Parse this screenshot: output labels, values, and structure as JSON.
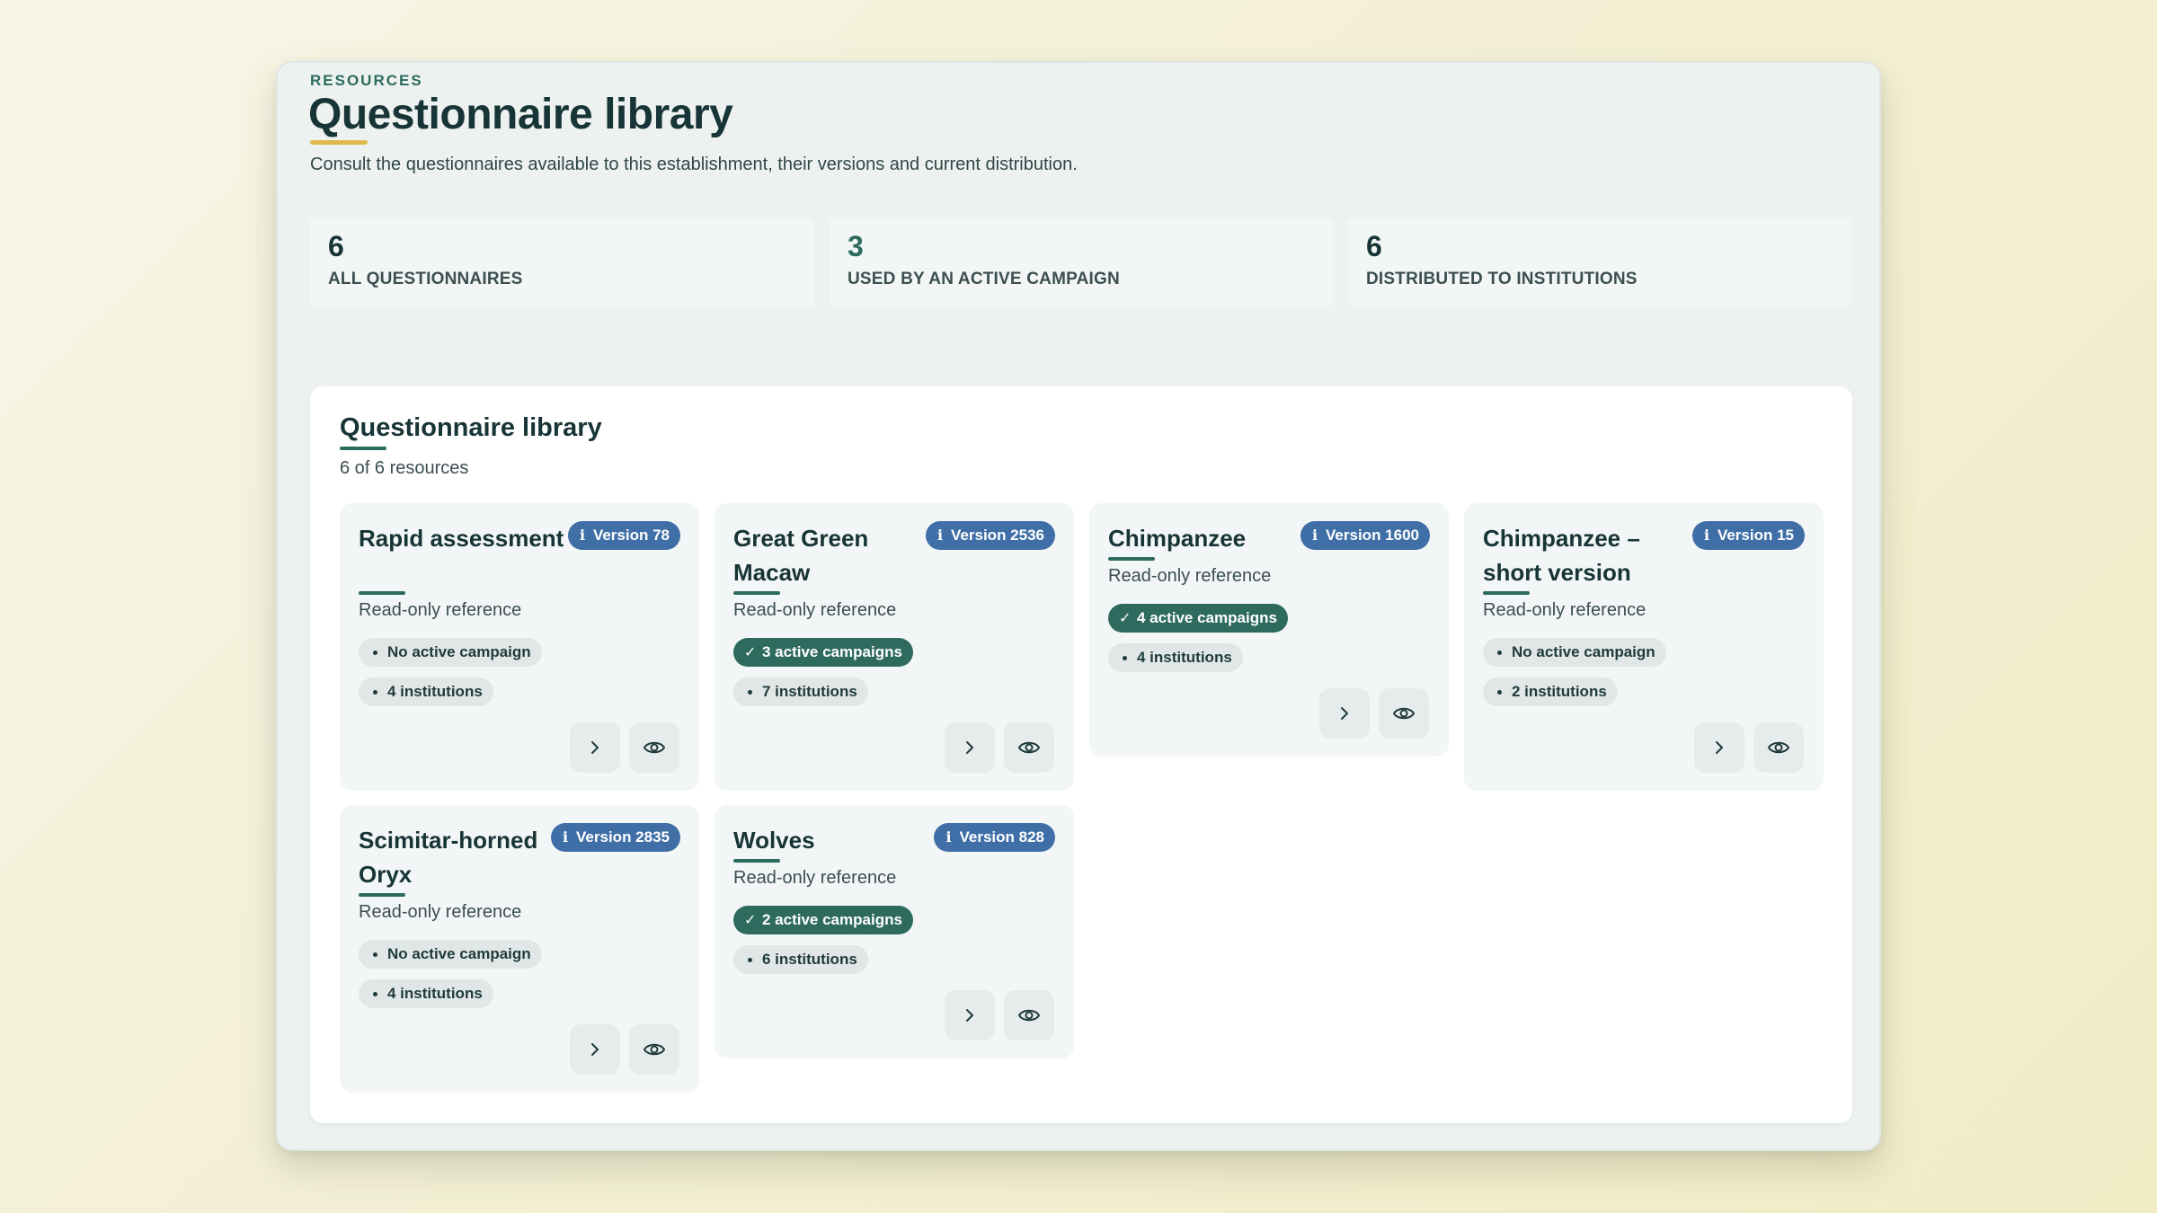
{
  "header": {
    "eyebrow": "RESOURCES",
    "title": "Questionnaire library",
    "subtitle": "Consult the questionnaires available to this establishment, their versions and current distribution."
  },
  "stats": [
    {
      "value": "6",
      "label": "ALL QUESTIONNAIRES"
    },
    {
      "value": "3",
      "label": "USED BY AN ACTIVE CAMPAIGN"
    },
    {
      "value": "6",
      "label": "DISTRIBUTED TO INSTITUTIONS"
    }
  ],
  "panel": {
    "title": "Questionnaire library",
    "count": "6 of 6 resources"
  },
  "colors": {
    "accent": "#2c6b5e",
    "version_badge": "#3f6fa6",
    "highlight": "#e0b94e"
  },
  "cards": [
    {
      "name": "Rapid assessment",
      "version": "Version 78",
      "subtitle": "Read-only reference",
      "campaign": "No active campaign",
      "campaign_active": false,
      "institutions": "4 institutions"
    },
    {
      "name": "Great Green Macaw",
      "version": "Version 2536",
      "subtitle": "Read-only reference",
      "campaign": "3 active campaigns",
      "campaign_active": true,
      "institutions": "7 institutions"
    },
    {
      "name": "Chimpanzee",
      "version": "Version 1600",
      "subtitle": "Read-only reference",
      "campaign": "4 active campaigns",
      "campaign_active": true,
      "institutions": "4 institutions"
    },
    {
      "name": "Chimpanzee – short version",
      "version": "Version 15",
      "subtitle": "Read-only reference",
      "campaign": "No active campaign",
      "campaign_active": false,
      "institutions": "2 institutions"
    },
    {
      "name": "Scimitar-horned Oryx",
      "version": "Version 2835",
      "subtitle": "Read-only reference",
      "campaign": "No active campaign",
      "campaign_active": false,
      "institutions": "4 institutions"
    },
    {
      "name": "Wolves",
      "version": "Version 828",
      "subtitle": "Read-only reference",
      "campaign": "2 active campaigns",
      "campaign_active": true,
      "institutions": "6 institutions"
    }
  ],
  "icons": {
    "version": "info-icon",
    "active": "check-icon",
    "inactive": "bullet-icon",
    "open": "chevron-right-icon",
    "preview": "eye-icon"
  }
}
